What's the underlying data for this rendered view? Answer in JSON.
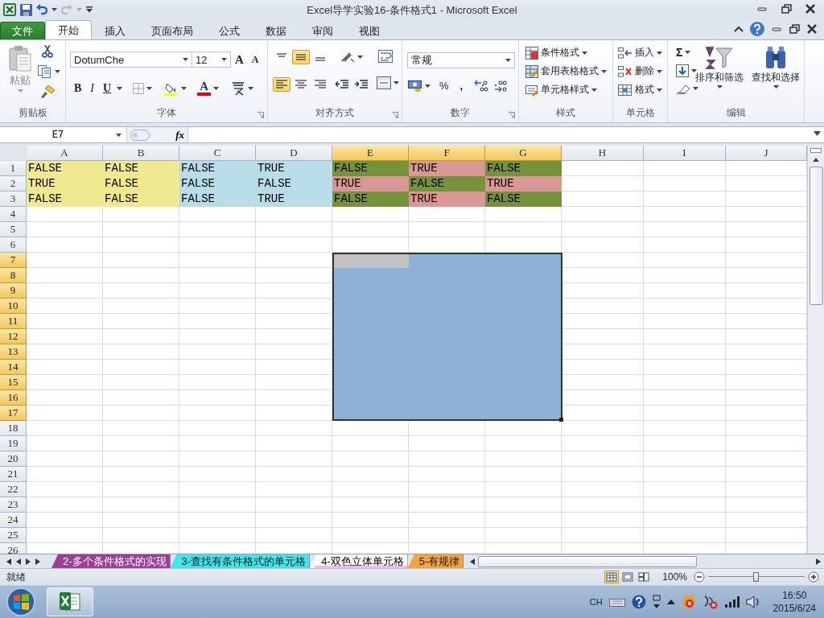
{
  "window": {
    "title": "Excel导学实验16-条件格式1  -  Microsoft Excel"
  },
  "menu_tabs": [
    {
      "label": "文件",
      "kind": "file",
      "selected": false
    },
    {
      "label": "开始",
      "kind": "tab",
      "selected": true
    },
    {
      "label": "插入",
      "kind": "tab",
      "selected": false
    },
    {
      "label": "页面布局",
      "kind": "tab",
      "selected": false
    },
    {
      "label": "公式",
      "kind": "tab",
      "selected": false
    },
    {
      "label": "数据",
      "kind": "tab",
      "selected": false
    },
    {
      "label": "审阅",
      "kind": "tab",
      "selected": false
    },
    {
      "label": "视图",
      "kind": "tab",
      "selected": false
    }
  ],
  "ribbon": {
    "clipboard": {
      "paste": "粘贴",
      "label": "剪贴板"
    },
    "font": {
      "font_name": "DotumChe",
      "font_size": "12",
      "grow": "A",
      "shrink": "A",
      "bold": "B",
      "italic": "I",
      "underline": "U",
      "font_color": "A",
      "label": "字体"
    },
    "alignment": {
      "buttons": [
        {
          "kind": "top",
          "selected": false
        },
        {
          "kind": "middle",
          "selected": true
        },
        {
          "kind": "bottom",
          "selected": false
        },
        {
          "kind": "left",
          "selected": true
        },
        {
          "kind": "center",
          "selected": false
        },
        {
          "kind": "right",
          "selected": false
        }
      ],
      "label": "对齐方式"
    },
    "number": {
      "format": "常规",
      "percent": "%",
      "comma": ",",
      "label": "数字"
    },
    "styles": {
      "items": [
        "条件格式",
        "套用表格格式",
        "单元格样式"
      ],
      "label": "样式"
    },
    "cells": {
      "items": [
        "插入",
        "删除",
        "格式"
      ],
      "label": "单元格"
    },
    "editing": {
      "sum": "Σ",
      "items": [
        "排序和筛选",
        "查找和选择"
      ],
      "label": "编辑"
    }
  },
  "formula_bar": {
    "name_box": "E7",
    "fx": "fx"
  },
  "sheet": {
    "columns": [
      {
        "label": "A",
        "selected": false
      },
      {
        "label": "B",
        "selected": false
      },
      {
        "label": "C",
        "selected": false
      },
      {
        "label": "D",
        "selected": false
      },
      {
        "label": "E",
        "selected": true
      },
      {
        "label": "F",
        "selected": true
      },
      {
        "label": "G",
        "selected": true
      },
      {
        "label": "H",
        "selected": false
      },
      {
        "label": "I",
        "selected": false
      },
      {
        "label": "J",
        "selected": false
      }
    ],
    "rows": [
      {
        "label": "1",
        "selected": false,
        "cells": [
          {
            "text": "FALSE",
            "color": "#f0e990"
          },
          {
            "text": "FALSE",
            "color": "#f0e990"
          },
          {
            "text": "FALSE",
            "color": "#b7dde8"
          },
          {
            "text": "TRUE",
            "color": "#b7dde8"
          },
          {
            "text": "FALSE",
            "color": "#76933c"
          },
          {
            "text": "TRUE",
            "color": "#da9694"
          },
          {
            "text": "FALSE",
            "color": "#76933c"
          }
        ]
      },
      {
        "label": "2",
        "selected": false,
        "cells": [
          {
            "text": "TRUE",
            "color": "#f0e990"
          },
          {
            "text": "FALSE",
            "color": "#f0e990"
          },
          {
            "text": "FALSE",
            "color": "#b7dde8"
          },
          {
            "text": "FALSE",
            "color": "#b7dde8"
          },
          {
            "text": "TRUE",
            "color": "#da9694"
          },
          {
            "text": "FALSE",
            "color": "#76933c"
          },
          {
            "text": "TRUE",
            "color": "#da9694"
          }
        ]
      },
      {
        "label": "3",
        "selected": false,
        "cells": [
          {
            "text": "FALSE",
            "color": "#f0e990"
          },
          {
            "text": "FALSE",
            "color": "#f0e990"
          },
          {
            "text": "FALSE",
            "color": "#b7dde8"
          },
          {
            "text": "TRUE",
            "color": "#b7dde8"
          },
          {
            "text": "FALSE",
            "color": "#76933c"
          },
          {
            "text": "TRUE",
            "color": "#da9694"
          },
          {
            "text": "FALSE",
            "color": "#76933c"
          }
        ]
      },
      {
        "label": "4",
        "selected": false
      },
      {
        "label": "5",
        "selected": false
      },
      {
        "label": "6",
        "selected": false
      },
      {
        "label": "7",
        "selected": true
      },
      {
        "label": "8",
        "selected": true
      },
      {
        "label": "9",
        "selected": true
      },
      {
        "label": "10",
        "selected": true
      },
      {
        "label": "11",
        "selected": true
      },
      {
        "label": "12",
        "selected": true
      },
      {
        "label": "13",
        "selected": true
      },
      {
        "label": "14",
        "selected": true
      },
      {
        "label": "15",
        "selected": true
      },
      {
        "label": "16",
        "selected": true
      },
      {
        "label": "17",
        "selected": true
      },
      {
        "label": "18",
        "selected": false
      },
      {
        "label": "19",
        "selected": false
      },
      {
        "label": "20",
        "selected": false
      },
      {
        "label": "21",
        "selected": false
      },
      {
        "label": "22",
        "selected": false
      },
      {
        "label": "23",
        "selected": false
      },
      {
        "label": "24",
        "selected": false
      },
      {
        "label": "25",
        "selected": false
      },
      {
        "label": "26",
        "selected": false
      }
    ]
  },
  "sheet_tabs": [
    {
      "label": "2-多个条件格式的实现",
      "selected": false,
      "color": "#9c3f98"
    },
    {
      "label": "3-查找有条件格式的单元格",
      "selected": false,
      "color": "#3ee6ee"
    },
    {
      "label": "4-双色立体单元格",
      "selected": true,
      "color": "#f3b8e8"
    },
    {
      "label": "5-有规律",
      "selected": false,
      "color": "#f4a43c"
    }
  ],
  "status_bar": {
    "status": "就绪",
    "views": [
      {
        "kind": "normal",
        "selected": true
      },
      {
        "kind": "layout",
        "selected": false
      },
      {
        "kind": "pagebreak",
        "selected": false
      }
    ],
    "zoom": "100%",
    "zoom_slider": {
      "level": 0.5
    }
  },
  "taskbar": {
    "language": "CH",
    "time": "16:50",
    "date": "2015/6/24"
  }
}
